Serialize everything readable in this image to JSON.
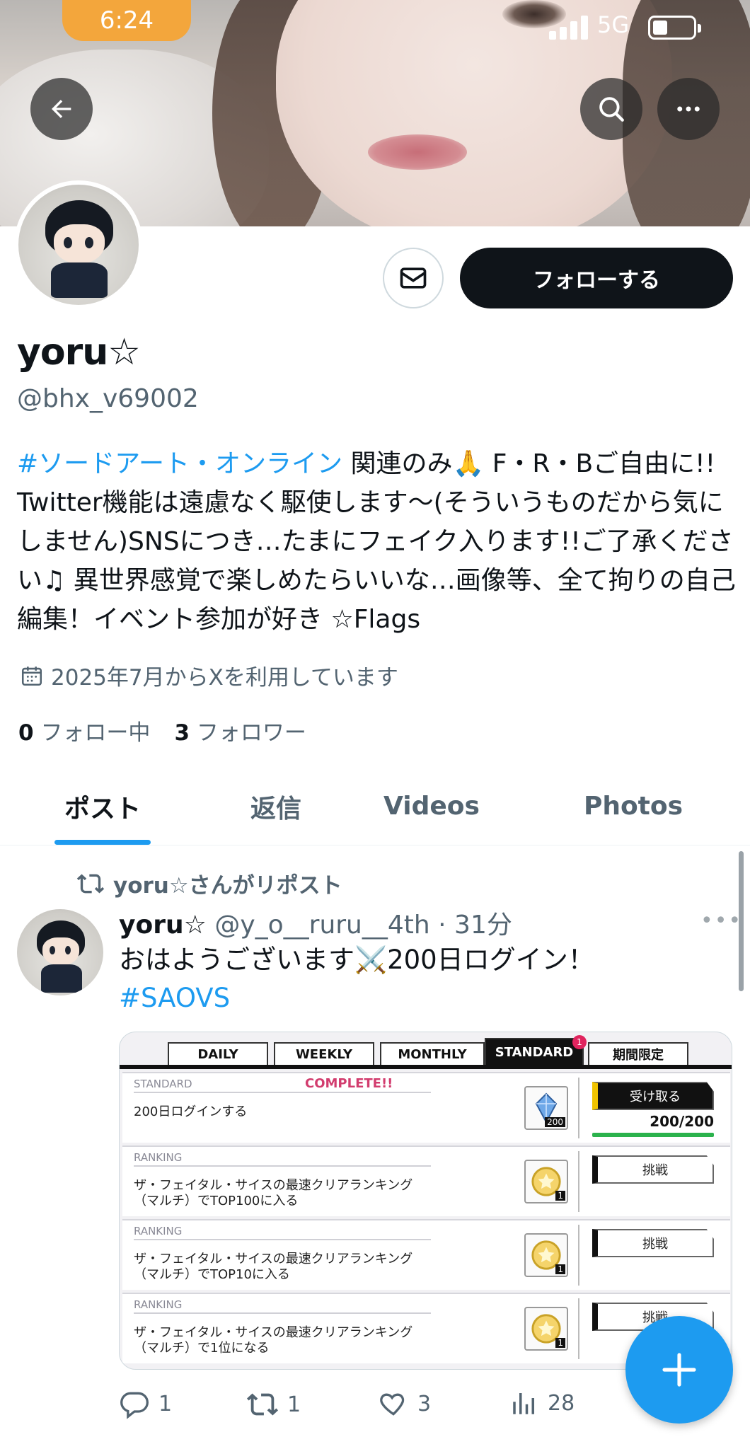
{
  "status_bar": {
    "time": "6:24",
    "network": "5G"
  },
  "profile": {
    "display_name": "yoru",
    "display_name_star": "☆",
    "handle": "@bhx_v69002",
    "follow_button": "フォローする",
    "bio": {
      "hashtag": "#ソードアート・オンライン",
      "text": " 関連のみ🙏 F・R・Bご自由に!! Twitter機能は遠慮なく駆使します〜(そういうものだから気にしません)SNSにつき…たまにフェイク入ります!!ご了承ください♫ 異世界感覚で楽しめたらいいな…画像等、全て拘りの自己編集！イベント参加が好き ☆Flags"
    },
    "joined": "2025年7月からXを利用しています",
    "following_count": "0",
    "following_label": "フォロー中",
    "followers_count": "3",
    "followers_label": "フォロワー"
  },
  "tabs": [
    {
      "label": "ポスト",
      "active": true
    },
    {
      "label": "返信",
      "active": false
    },
    {
      "label": "Videos",
      "active": false
    },
    {
      "label": "Photos",
      "active": false
    }
  ],
  "post": {
    "repost_label": "yoru☆さんがリポスト",
    "author_name": "yoru☆",
    "author_meta": "@y_o__ruru__4th · 31分",
    "text": "おはようございます⚔️200日ログイン！",
    "hashtag": "#SAOVS",
    "media": {
      "tabs": [
        "DAILY",
        "WEEKLY",
        "MONTHLY",
        "STANDARD",
        "期間限定"
      ],
      "badge": "1",
      "rows": [
        {
          "category": "STANDARD",
          "status": "COMPLETE!!",
          "desc": "200日ログインする",
          "qty": "200",
          "action": "受け取る",
          "progress": "200/200"
        },
        {
          "category": "RANKING",
          "status": "",
          "desc": "ザ・フェイタル・サイスの最速クリアランキング（マルチ）でTOP100に入る",
          "qty": "1",
          "action": "挑戦",
          "progress": ""
        },
        {
          "category": "RANKING",
          "status": "",
          "desc": "ザ・フェイタル・サイスの最速クリアランキング（マルチ）でTOP10に入る",
          "qty": "1",
          "action": "挑戦",
          "progress": ""
        },
        {
          "category": "RANKING",
          "status": "",
          "desc": "ザ・フェイタル・サイスの最速クリアランキング（マルチ）で1位になる",
          "qty": "1",
          "action": "挑戦",
          "progress": ""
        }
      ]
    },
    "replies": "1",
    "reposts": "1",
    "likes": "3",
    "views": "28"
  },
  "colors": {
    "accent": "#1d9bf0",
    "text": "#0f1419",
    "muted": "#536471",
    "time_pill": "#f3a63c"
  }
}
